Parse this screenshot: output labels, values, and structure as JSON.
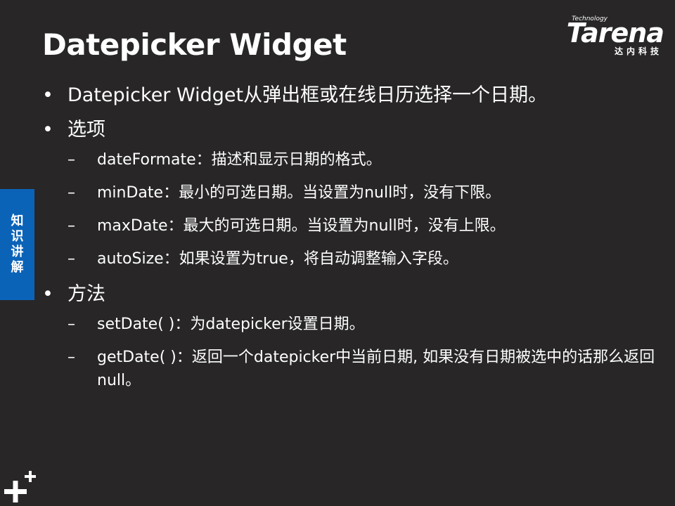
{
  "slide": {
    "title": "Datepicker Widget",
    "side_tab": [
      "知",
      "识",
      "讲",
      "解"
    ],
    "logo": {
      "tagline": "Technology",
      "word": "Tarena",
      "chinese": "达内科技"
    },
    "bullet_symbol": "•",
    "dash_symbol": "–",
    "items": [
      {
        "text": "Datepicker Widget从弹出框或在线日历选择一个日期。",
        "children": []
      },
      {
        "text": "选项",
        "children": [
          "dateFormate：描述和显示日期的格式。",
          "minDate：最小的可选日期。当设置为null时，没有下限。",
          "maxDate：最大的可选日期。当设置为null时，没有上限。",
          "autoSize：如果设置为true，将自动调整输入字段。"
        ]
      },
      {
        "text": "方法",
        "children": [
          "setDate( )：为datepicker设置日期。",
          "getDate( )：返回一个datepicker中当前日期, 如果没有日期被选中的话那么返回null。"
        ]
      }
    ]
  },
  "colors": {
    "background": "#282626",
    "text": "#ffffff",
    "side_tab": "#0b63b8"
  }
}
